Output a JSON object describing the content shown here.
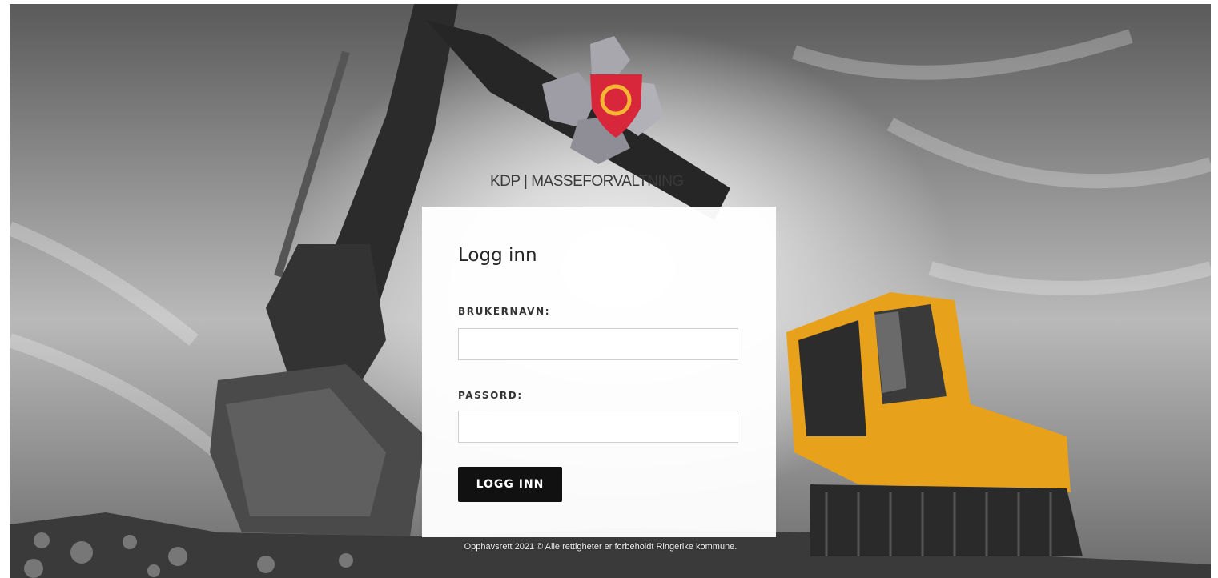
{
  "brand": {
    "title": "KDP | MASSEFORVALTNING"
  },
  "login": {
    "heading": "Logg inn",
    "username_label": "BRUKERNAVN:",
    "username_value": "",
    "password_label": "PASSORD:",
    "password_value": "",
    "submit_label": "LOGG INN"
  },
  "footer": {
    "text": "Opphavsrett 2021 © Alle rettigheter er forbeholdt Ringerike kommune."
  },
  "icons": {
    "logo": "municipal-shield-logo"
  },
  "colors": {
    "button": "#111111",
    "shield": "#d8263a",
    "ring": "#f5b733",
    "machine": "#e8a11a"
  }
}
